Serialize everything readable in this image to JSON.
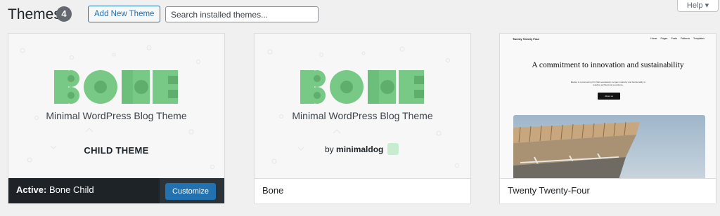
{
  "header": {
    "title": "Themes",
    "count": "4",
    "add_new_label": "Add New Theme",
    "search_placeholder": "Search installed themes...",
    "help_label": "Help ▾"
  },
  "themes": [
    {
      "name": "Bone Child",
      "active_prefix": "Active:",
      "customize_label": "Customize",
      "logo_text": "BONE",
      "tagline": "Minimal WordPress Blog Theme",
      "subtitle": "CHILD THEME"
    },
    {
      "name": "Bone",
      "logo_text": "BONE",
      "tagline": "Minimal WordPress Blog Theme",
      "byline_prefix": "by",
      "byline_author": "minimaldog"
    },
    {
      "name": "Twenty Twenty-Four",
      "preview": {
        "brand": "Twenty Twenty Four",
        "nav": "Home Pages Posts Patterns Templates",
        "headline": "A commitment to innovation and sustainability",
        "body": "Études is a pioneering firm that seamlessly merges creativity and functionality to redefine architectural excellence.",
        "cta": "About us"
      }
    }
  ],
  "colors": {
    "brand_green": "#77c985",
    "accent_blue": "#2271b1",
    "dark_bar": "#1d2327"
  }
}
